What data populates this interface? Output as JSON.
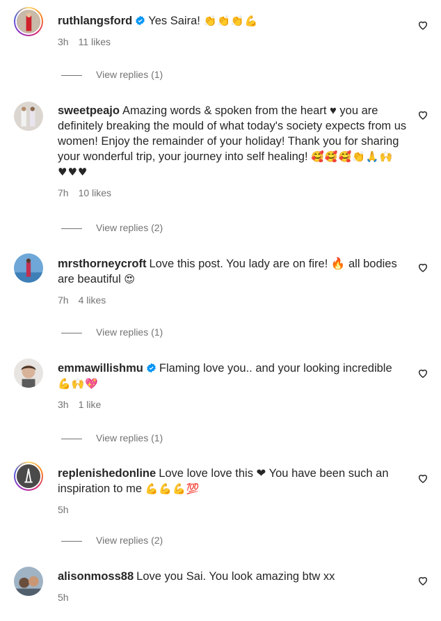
{
  "comments": [
    {
      "username": "ruthlangsford",
      "verified": true,
      "text": "Yes Saira!",
      "emoji": "👏👏👏💪",
      "time": "3h",
      "likes": "11 likes",
      "replies": "View replies (1)"
    },
    {
      "username": "sweetpeajo",
      "verified": false,
      "text": "Amazing words & spoken from the heart ♥ you are definitely breaking the mould of what today's society expects from us women! Enjoy the remainder of your holiday! Thank you for sharing your wonderful trip, your journey into self healing!",
      "emoji": "🥰🥰🥰👏🙏🙌♥♥♥",
      "time": "7h",
      "likes": "10 likes",
      "replies": "View replies (2)"
    },
    {
      "username": "mrsthorneycroft",
      "verified": false,
      "text": "Love this post. You lady are on fire! 🔥 all bodies are beautiful",
      "emoji": "😍",
      "time": "7h",
      "likes": "4 likes",
      "replies": "View replies (1)"
    },
    {
      "username": "emmawillishmu",
      "verified": true,
      "text": "Flaming love you.. and your looking incredible",
      "emoji": "💪🙌💖",
      "time": "3h",
      "likes": "1 like",
      "replies": "View replies (1)"
    },
    {
      "username": "replenishedonline",
      "verified": false,
      "text": "Love love love this ❤ You have been such an inspiration to me",
      "emoji": "💪💪💪💯",
      "time": "5h",
      "likes": "",
      "replies": "View replies (2)"
    },
    {
      "username": "alisonmoss88",
      "verified": false,
      "text": "Love you Sai. You look amazing btw xx",
      "emoji": "",
      "time": "5h",
      "likes": "",
      "replies": ""
    }
  ],
  "icons": {
    "verified": "verified-badge-icon",
    "like": "heart-outline-icon"
  },
  "colors": {
    "verified": "#0095f6",
    "muted": "#737373",
    "text": "#262626"
  }
}
